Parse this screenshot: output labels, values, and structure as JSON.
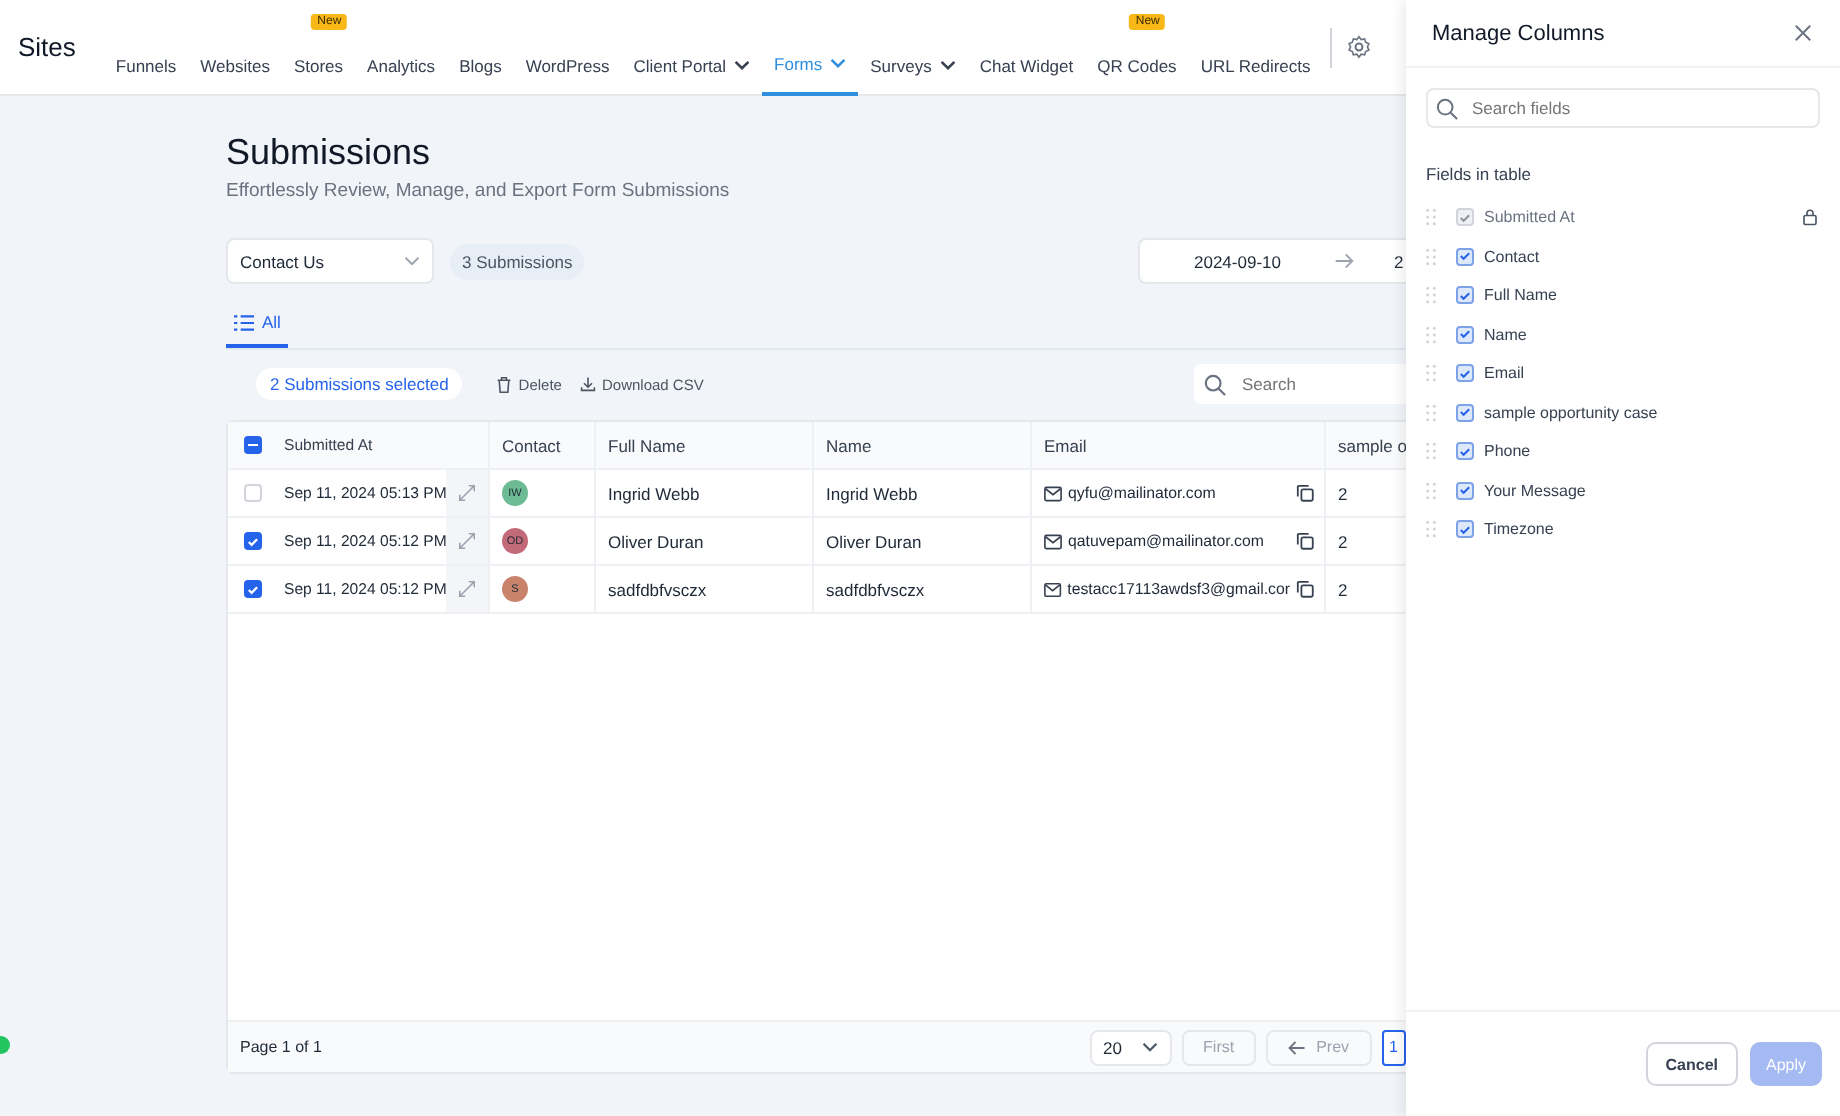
{
  "nav": {
    "brand": "Sites",
    "items": [
      {
        "label": "Funnels",
        "selected": false
      },
      {
        "label": "Websites",
        "selected": false
      },
      {
        "label": "Stores",
        "selected": false,
        "badge": "New"
      },
      {
        "label": "Analytics",
        "selected": false
      },
      {
        "label": "Blogs",
        "selected": false
      },
      {
        "label": "WordPress",
        "selected": false
      },
      {
        "label": "Client Portal",
        "selected": false,
        "dropdown": true
      },
      {
        "label": "Forms",
        "selected": true,
        "dropdown": true
      },
      {
        "label": "Surveys",
        "selected": false,
        "dropdown": true
      },
      {
        "label": "Chat Widget",
        "selected": false
      },
      {
        "label": "QR Codes",
        "selected": false,
        "badge": "New"
      },
      {
        "label": "URL Redirects",
        "selected": false
      }
    ]
  },
  "page": {
    "title": "Submissions",
    "subtitle": "Effortlessly Review, Manage, and Export Form Submissions"
  },
  "filters": {
    "form": "Contact Us",
    "count": "3 Submissions",
    "start_date": "2024-09-10",
    "end_date": "2"
  },
  "tabs": [
    {
      "label": "All",
      "selected": true
    }
  ],
  "toolbar": {
    "selection": "2 Submissions selected",
    "delete": "Delete",
    "download": "Download CSV",
    "search": {
      "placeholder": "Search"
    }
  },
  "table": {
    "select_all": {
      "indeterminate": true
    },
    "columns": [
      "Submitted At",
      "Contact",
      "Full Name",
      "Name",
      "Email",
      "sample o"
    ],
    "rows": [
      {
        "selected": false,
        "submitted": "Sep 11, 2024  05:13 PM",
        "initials": "IW",
        "color": "#6dbb94",
        "full_name": "Ingrid Webb",
        "name": "Ingrid Webb",
        "email": "qyfu@mailinator.com",
        "sample": "2"
      },
      {
        "selected": true,
        "submitted": "Sep 11, 2024  05:12 PM",
        "initials": "OD",
        "color": "#c26a78",
        "full_name": "Oliver Duran",
        "name": "Oliver Duran",
        "email": "qatuvepam@mailinator.com",
        "sample": "2"
      },
      {
        "selected": true,
        "submitted": "Sep 11, 2024  05:12 PM",
        "initials": "S",
        "color": "#c8836a",
        "full_name": "sadfdbfvsczx",
        "name": "sadfdbfvsczx",
        "email": "testacc17113awdsf3@gmail.cor",
        "sample": "2"
      }
    ]
  },
  "pagination": {
    "page": "Page 1 of 1",
    "size": "20",
    "first": "First",
    "prev": "Prev",
    "current": "1"
  },
  "drawer": {
    "title": "Manage Columns",
    "search": {
      "placeholder": "Search fields"
    },
    "section": "Fields in table",
    "fields": [
      {
        "label": "Submitted At",
        "checked": true,
        "disabled": true
      },
      {
        "label": "Contact",
        "checked": true,
        "disabled": false
      },
      {
        "label": "Full Name",
        "checked": true,
        "disabled": false
      },
      {
        "label": "Name",
        "checked": true,
        "disabled": false
      },
      {
        "label": "Email",
        "checked": true,
        "disabled": false
      },
      {
        "label": "sample opportunity case",
        "checked": true,
        "disabled": false
      },
      {
        "label": "Phone",
        "checked": true,
        "disabled": false
      },
      {
        "label": "Your Message",
        "checked": true,
        "disabled": false
      },
      {
        "label": "Timezone",
        "checked": true,
        "disabled": false
      }
    ],
    "cancel": "Cancel",
    "apply": {
      "label": "Apply",
      "disabled": true
    }
  }
}
